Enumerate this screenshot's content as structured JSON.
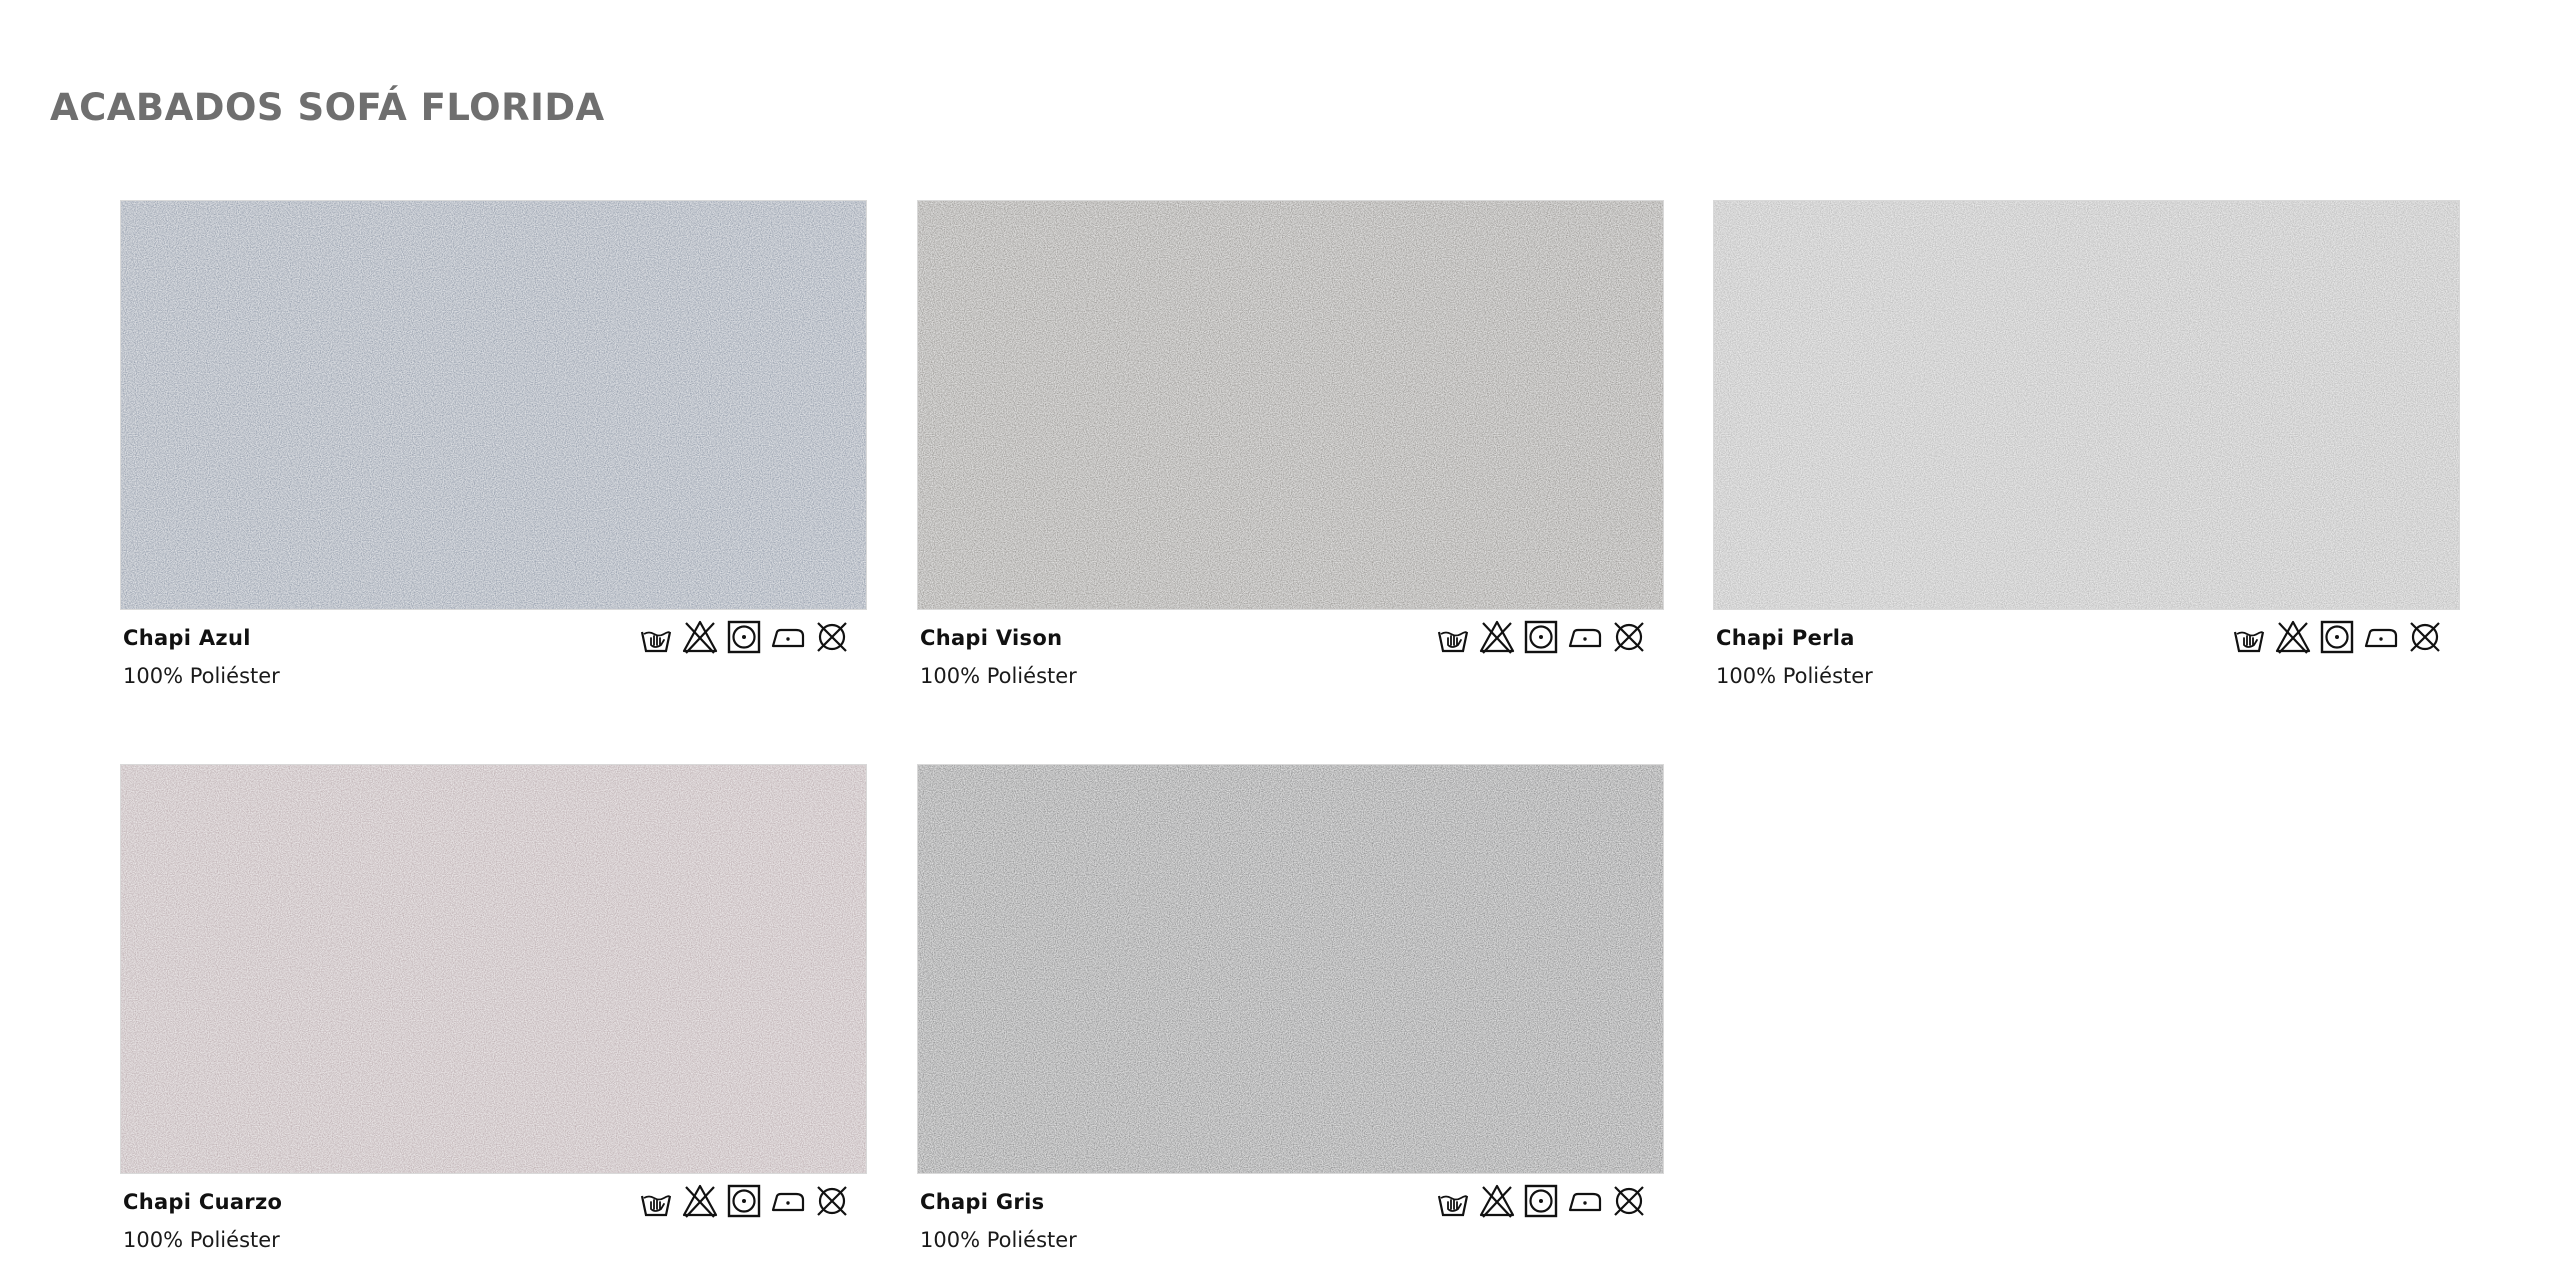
{
  "page": {
    "title": "ACABADOS SOFÁ FLORIDA"
  },
  "fabrics": [
    {
      "name": "Chapi Azul",
      "composition": "100% Poliéster",
      "color": "#6f7f96"
    },
    {
      "name": "Chapi Vison",
      "composition": "100% Poliéster",
      "color": "#7b7771"
    },
    {
      "name": "Chapi Perla",
      "composition": "100% Poliéster",
      "color": "#aaaaaa"
    },
    {
      "name": "Chapi Cuarzo",
      "composition": "100% Poliéster",
      "color": "#ae9a9e"
    },
    {
      "name": "Chapi Gris",
      "composition": "100% Poliéster",
      "color": "#666769"
    }
  ],
  "care_icons": [
    "hand-wash-icon",
    "do-not-bleach-icon",
    "tumble-dry-icon",
    "iron-low-icon",
    "do-not-dry-clean-icon"
  ]
}
